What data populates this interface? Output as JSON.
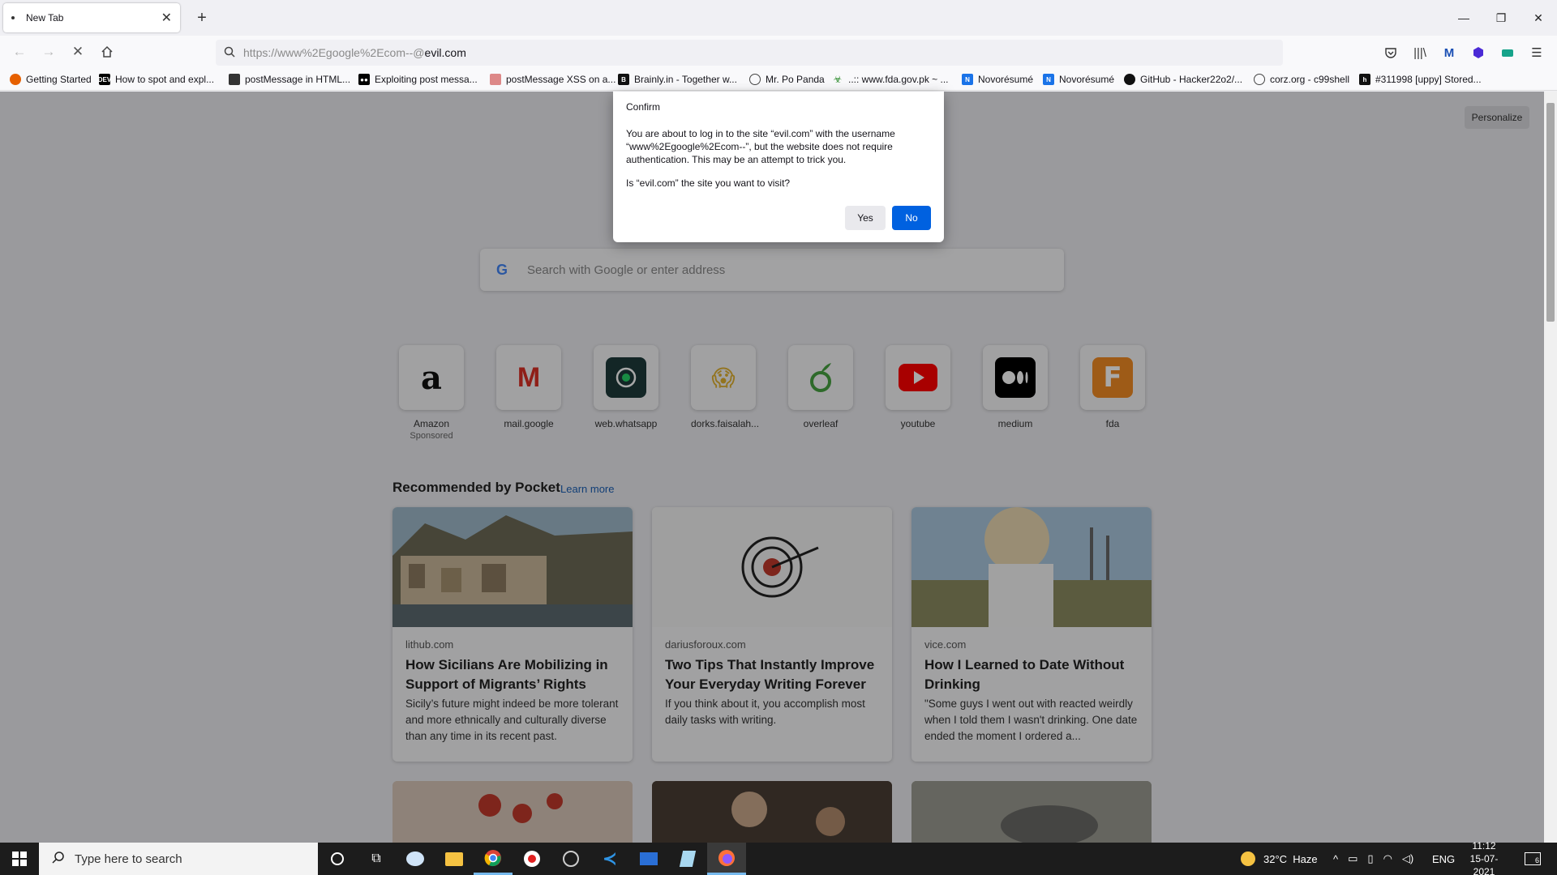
{
  "browser": {
    "tab_title": "New Tab",
    "url_prefix": "https://www%2Egoogle%2Ecom--@",
    "url_host": "evil.com"
  },
  "bookmarks": [
    {
      "label": "Getting Started",
      "icon": "firefox-icon",
      "color": "#e66000"
    },
    {
      "label": "How to spot and expl...",
      "icon": "dev-icon",
      "color": "#000000"
    },
    {
      "label": "postMessage in HTML...",
      "icon": "page-icon",
      "color": "#333333"
    },
    {
      "label": "Exploiting post messa...",
      "icon": "medium-icon",
      "color": "#000000"
    },
    {
      "label": "postMessage XSS on a...",
      "icon": "page-icon",
      "color": "#c44"
    },
    {
      "label": "Brainly.in - Together w...",
      "icon": "brainly-icon",
      "color": "#111111"
    },
    {
      "label": "Mr. Po Panda",
      "icon": "globe-icon",
      "color": "#444444"
    },
    {
      "label": "..:: www.fda.gov.pk ~ ...",
      "icon": "biohazard-icon",
      "color": "#2a8a2a"
    },
    {
      "label": "Novorésumé",
      "icon": "novoresume-icon",
      "color": "#1a73e8"
    },
    {
      "label": "Novorésumé",
      "icon": "novoresume-icon",
      "color": "#1a73e8"
    },
    {
      "label": "GitHub - Hacker22o2/...",
      "icon": "github-icon",
      "color": "#111111"
    },
    {
      "label": "corz.org - c99shell",
      "icon": "globe-icon",
      "color": "#444444"
    },
    {
      "label": "#311998 [uppy] Stored...",
      "icon": "hackerone-icon",
      "color": "#111111"
    }
  ],
  "content": {
    "personalize": "Personalize",
    "search_placeholder": "Search with Google or enter address",
    "top_sites": [
      {
        "label": "Amazon",
        "sub": "Sponsored",
        "icon": "amazon-icon"
      },
      {
        "label": "mail.google",
        "sub": "",
        "icon": "gmail-icon"
      },
      {
        "label": "web.whatsapp",
        "sub": "",
        "icon": "whatsapp-icon"
      },
      {
        "label": "dorks.faisalah...",
        "sub": "",
        "icon": "emoji-icon"
      },
      {
        "label": "overleaf",
        "sub": "",
        "icon": "overleaf-icon"
      },
      {
        "label": "youtube",
        "sub": "",
        "icon": "youtube-icon"
      },
      {
        "label": "medium",
        "sub": "",
        "icon": "medium-icon"
      },
      {
        "label": "fda",
        "sub": "",
        "icon": "fda-icon"
      }
    ],
    "pocket_heading": "Recommended by Pocket",
    "pocket_learn": "Learn more",
    "cards": [
      {
        "source": "lithub.com",
        "title": "How Sicilians Are Mobilizing in Support of Migrants’ Rights",
        "excerpt": "Sicily’s future might indeed be more tolerant and more ethnically and culturally diverse than any time in its recent past."
      },
      {
        "source": "dariusforoux.com",
        "title": "Two Tips That Instantly Improve Your Everyday Writing Forever",
        "excerpt": "If you think about it, you accomplish most daily tasks with writing."
      },
      {
        "source": "vice.com",
        "title": "How I Learned to Date Without Drinking",
        "excerpt": "\"Some guys I went out with reacted weirdly when I told them I wasn't drinking. One date ended the moment I ordered a..."
      }
    ]
  },
  "dialog": {
    "title": "Confirm",
    "message": "You are about to log in to the site “evil.com” with the username “www%2Egoogle%2Ecom--”, but the website does not require authentication. This may be an attempt to trick you.",
    "question": "Is “evil.com” the site you want to visit?",
    "yes": "Yes",
    "no": "No"
  },
  "taskbar": {
    "search_placeholder": "Type here to search",
    "weather": "32°C  Haze",
    "lang": "ENG",
    "time": "11:12",
    "date": "15-07-2021",
    "notifications": "6"
  }
}
